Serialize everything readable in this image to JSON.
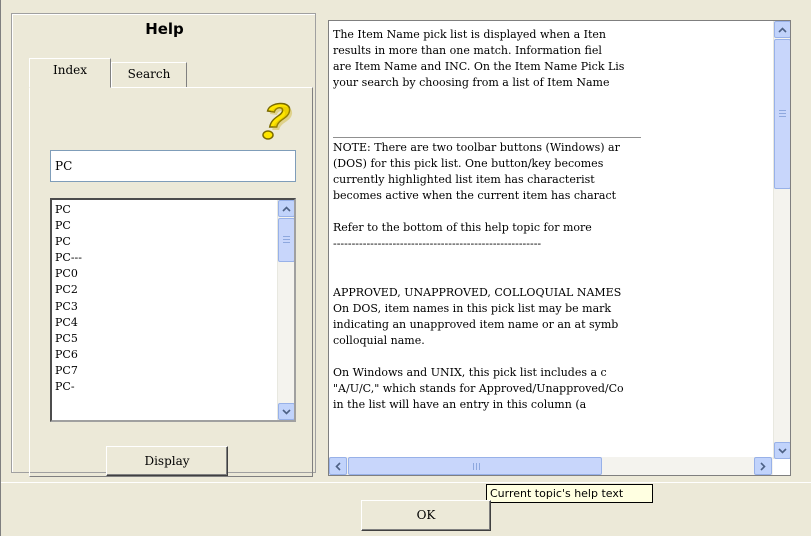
{
  "left_panel": {
    "title": "Help",
    "tabs": [
      {
        "label": "Index",
        "active": true
      },
      {
        "label": "Search",
        "active": false
      }
    ],
    "help_icon": "question-mark-icon",
    "search_value": "PC",
    "list_items": [
      "PC",
      "PC",
      "PC",
      "PC---",
      "PC0",
      "PC2",
      "PC3",
      "PC4",
      "PC5",
      "PC6",
      "PC7",
      "PC-"
    ],
    "display_button_label": "Display"
  },
  "text_pane": {
    "lines": [
      "The Item Name pick list is displayed when a Iten",
      "results in more than one match. Information fiel",
      "are Item Name and INC. On the Item Name Pick Lis",
      "your search by choosing from a list of Item Name",
      "",
      "",
      "________________________________________________________",
      "NOTE: There are two toolbar buttons (Windows) ar",
      "(DOS) for this pick list. One button/key becomes",
      "currently highlighted list item has characterist",
      "becomes active when the current item has charact",
      "",
      "Refer to the bottom of this help topic for more",
      "--------------------------------------------------------",
      "",
      "",
      "APPROVED, UNAPPROVED, COLLOQUIAL NAMES",
      "On DOS, item names in this pick list may be mark",
      "indicating an unapproved item name or an at symb",
      "colloquial name.",
      "",
      "On Windows and UNIX, this pick list includes a c",
      "\"A/U/C,\" which stands for Approved/Unapproved/Co",
      "in the list will have an entry in this column (a"
    ]
  },
  "tooltip_text": "Current topic's help text",
  "ok_button_label": "OK",
  "colors": {
    "window_bg": "#ece9d8",
    "scrollbar_button": "#c1d3fb",
    "tooltip_bg": "#ffffe1"
  }
}
